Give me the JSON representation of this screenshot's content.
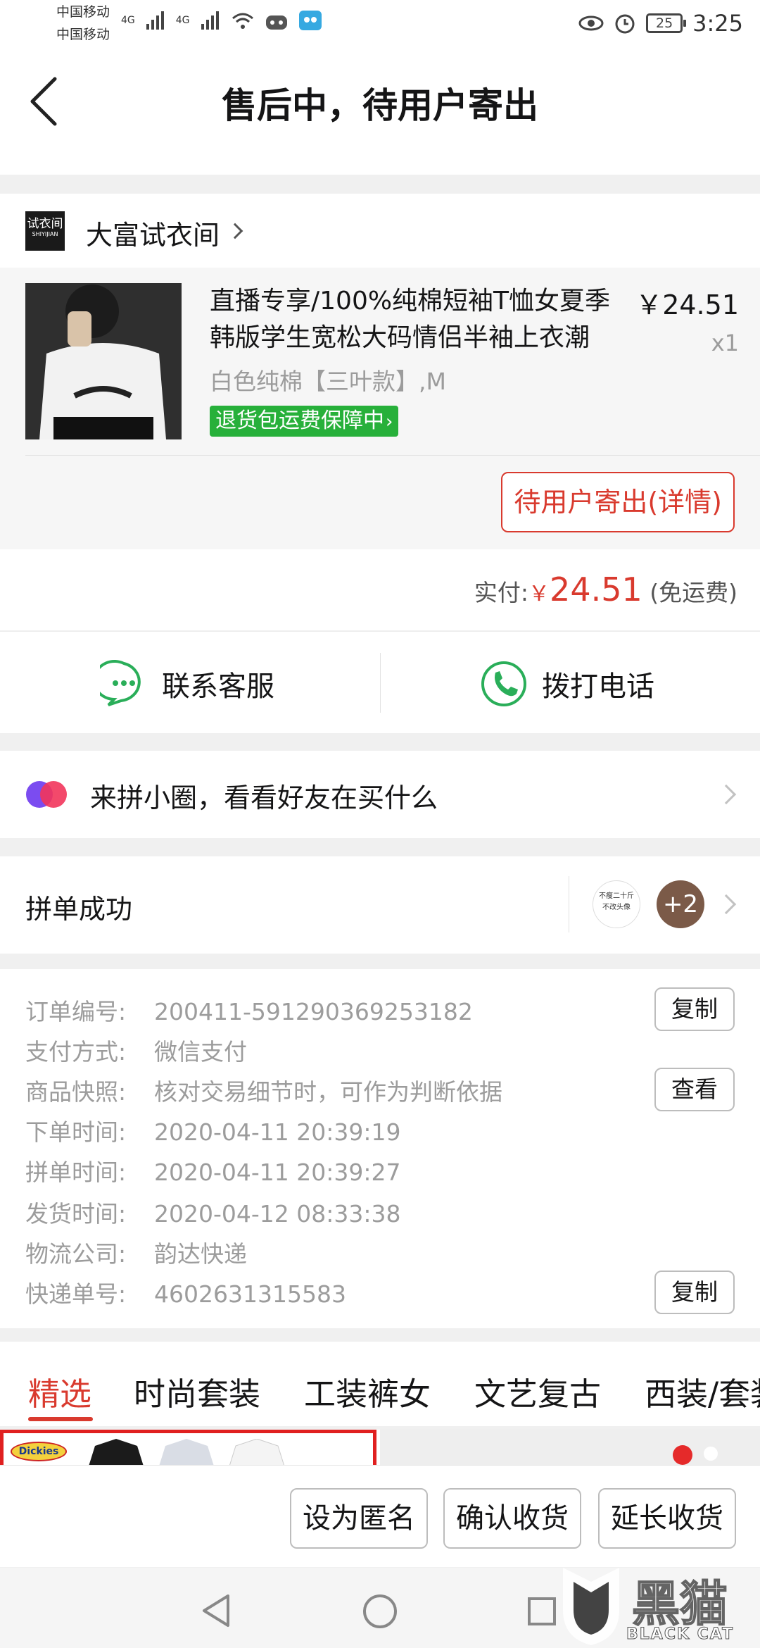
{
  "status_bar": {
    "carrier1": "中国移动",
    "carrier2": "中国移动",
    "net1": "4G",
    "net2": "4G",
    "battery": "25",
    "time": "3:25"
  },
  "header": {
    "title": "售后中，待用户寄出"
  },
  "shop": {
    "logo_text": "试衣间",
    "logo_sub": "SHIYIJIAN",
    "name": "大富试衣间"
  },
  "goods": {
    "title": "直播专享/100%纯棉短袖T恤女夏季韩版学生宽松大码情侣半袖上衣潮",
    "price": "￥24.51",
    "qty": "x1",
    "spec": "白色纯棉【三叶款】,M",
    "tag": "退货包运费保障中",
    "status_button": "待用户寄出(详情)"
  },
  "payment": {
    "label": "实付:",
    "currency": "￥",
    "amount": "24.51",
    "note": "(免运费)"
  },
  "contact": {
    "service": "联系客服",
    "call": "拨打电话"
  },
  "circle": {
    "text": "来拼小圈，看看好友在买什么"
  },
  "group": {
    "text": "拼单成功",
    "avatar1_line1": "不瘦二十斤",
    "avatar1_line2": "不改头像",
    "more": "+2"
  },
  "order_info": {
    "rows": [
      {
        "label": "订单编号:",
        "value": "200411-591290369253182"
      },
      {
        "label": "支付方式:",
        "value": "微信支付"
      },
      {
        "label": "商品快照:",
        "value": "核对交易细节时，可作为判断依据"
      },
      {
        "label": "下单时间:",
        "value": "2020-04-11 20:39:19"
      },
      {
        "label": "拼单时间:",
        "value": "2020-04-11 20:39:27"
      },
      {
        "label": "发货时间:",
        "value": "2020-04-12 08:33:38"
      },
      {
        "label": "物流公司:",
        "value": "韵达快递"
      },
      {
        "label": "快递单号:",
        "value": "4602631315583"
      }
    ],
    "copy_label": "复制",
    "view_label": "查看"
  },
  "tabs": [
    "精选",
    "时尚套装",
    "工装裤女",
    "文艺复古",
    "西装/套装"
  ],
  "promo": {
    "brand": "Dickies"
  },
  "actions": {
    "anonymous": "设为匿名",
    "confirm": "确认收货",
    "extend": "延长收货"
  },
  "watermark": {
    "cn": "黑猫",
    "en": "BLACK CAT"
  },
  "colors": {
    "accent": "#d93a2e",
    "green": "#27b03a",
    "contact_green": "#2aae59"
  }
}
